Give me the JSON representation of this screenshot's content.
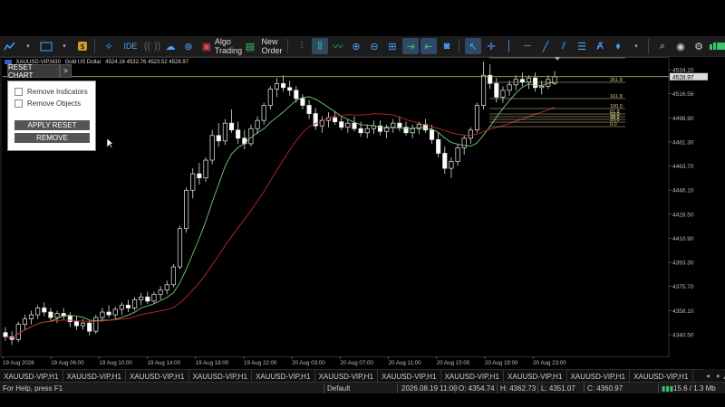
{
  "toolbar": {
    "algo_trading_label": "Algo Trading",
    "new_order_label": "New Order",
    "ide_label": "IDE"
  },
  "chart_info": {
    "symbol": "XAUUSD-VIP,M30",
    "description": "Gold US Dollar",
    "ohlc": "4524.16 4532.76 4523.52 4528.97"
  },
  "reset_chart": {
    "button_label": "RESET CHART",
    "arrow_label": ">",
    "remove_indicators_label": "Remove Indicators",
    "remove_objects_label": "Remove Objects",
    "apply_reset_label": "APPLY RESET",
    "remove_label": "REMOVE"
  },
  "chart_data": {
    "type": "candlestick",
    "current_price": "4528.97",
    "price_ticks": [
      "4534.10",
      "4516.56",
      "4498.90",
      "4481.30",
      "4463.70",
      "4446.10",
      "4428.50",
      "4410.90",
      "4393.30",
      "4375.70",
      "4358.10",
      "4340.50"
    ],
    "time_ticks": [
      "19 Aug 2026",
      "19 Aug 06:00",
      "19 Aug 10:00",
      "19 Aug 14:00",
      "19 Aug 18:00",
      "19 Aug 22:00",
      "20 Aug 03:00",
      "20 Aug 07:00",
      "20 Aug 11:00",
      "20 Aug 15:00",
      "20 Aug 19:00",
      "20 Aug 23:00"
    ],
    "fib_levels": [
      "423.6",
      "261.8",
      "161.8",
      "100.0",
      "61.8",
      "50.0",
      "38.2",
      "23.6",
      "0.0"
    ],
    "candles": [
      [
        4342,
        4346,
        4336,
        4339
      ],
      [
        4339,
        4343,
        4333,
        4337
      ],
      [
        4337,
        4350,
        4335,
        4348
      ],
      [
        4348,
        4355,
        4344,
        4352
      ],
      [
        4352,
        4358,
        4348,
        4355
      ],
      [
        4355,
        4362,
        4352,
        4360
      ],
      [
        4360,
        4364,
        4354,
        4357
      ],
      [
        4357,
        4360,
        4350,
        4353
      ],
      [
        4353,
        4358,
        4349,
        4356
      ],
      [
        4356,
        4360,
        4351,
        4354
      ],
      [
        4354,
        4357,
        4346,
        4350
      ],
      [
        4350,
        4354,
        4344,
        4347
      ],
      [
        4347,
        4352,
        4344,
        4349
      ],
      [
        4349,
        4351,
        4340,
        4343
      ],
      [
        4343,
        4355,
        4341,
        4353
      ],
      [
        4353,
        4360,
        4350,
        4357
      ],
      [
        4357,
        4362,
        4353,
        4355
      ],
      [
        4355,
        4361,
        4352,
        4359
      ],
      [
        4359,
        4364,
        4355,
        4362
      ],
      [
        4362,
        4366,
        4357,
        4360
      ],
      [
        4360,
        4368,
        4358,
        4366
      ],
      [
        4366,
        4371,
        4362,
        4368
      ],
      [
        4368,
        4372,
        4363,
        4365
      ],
      [
        4365,
        4372,
        4363,
        4370
      ],
      [
        4370,
        4376,
        4366,
        4373
      ],
      [
        4373,
        4380,
        4370,
        4377
      ],
      [
        4377,
        4392,
        4375,
        4390
      ],
      [
        4390,
        4420,
        4388,
        4418
      ],
      [
        4418,
        4448,
        4415,
        4446
      ],
      [
        4446,
        4462,
        4440,
        4458
      ],
      [
        4458,
        4466,
        4450,
        4455
      ],
      [
        4455,
        4470,
        4452,
        4468
      ],
      [
        4468,
        4490,
        4465,
        4486
      ],
      [
        4486,
        4495,
        4478,
        4482
      ],
      [
        4482,
        4498,
        4479,
        4495
      ],
      [
        4495,
        4505,
        4488,
        4490
      ],
      [
        4490,
        4496,
        4480,
        4484
      ],
      [
        4484,
        4490,
        4476,
        4480
      ],
      [
        4480,
        4494,
        4478,
        4491
      ],
      [
        4491,
        4500,
        4487,
        4497
      ],
      [
        4497,
        4510,
        4494,
        4508
      ],
      [
        4508,
        4522,
        4505,
        4520
      ],
      [
        4520,
        4528,
        4514,
        4524
      ],
      [
        4524,
        4530,
        4518,
        4521
      ],
      [
        4521,
        4526,
        4515,
        4519
      ],
      [
        4519,
        4522,
        4510,
        4513
      ],
      [
        4513,
        4516,
        4505,
        4508
      ],
      [
        4508,
        4512,
        4498,
        4502
      ],
      [
        4502,
        4506,
        4490,
        4493
      ],
      [
        4493,
        4500,
        4488,
        4497
      ],
      [
        4497,
        4503,
        4492,
        4499
      ],
      [
        4499,
        4504,
        4494,
        4496
      ],
      [
        4496,
        4500,
        4490,
        4492
      ],
      [
        4492,
        4498,
        4488,
        4495
      ],
      [
        4495,
        4500,
        4489,
        4491
      ],
      [
        4491,
        4496,
        4485,
        4488
      ],
      [
        4488,
        4494,
        4484,
        4491
      ],
      [
        4491,
        4497,
        4487,
        4493
      ],
      [
        4493,
        4497,
        4486,
        4489
      ],
      [
        4489,
        4494,
        4484,
        4492
      ],
      [
        4492,
        4498,
        4488,
        4495
      ],
      [
        4495,
        4500,
        4489,
        4492
      ],
      [
        4492,
        4496,
        4486,
        4488
      ],
      [
        4488,
        4494,
        4484,
        4491
      ],
      [
        4491,
        4496,
        4487,
        4494
      ],
      [
        4494,
        4498,
        4488,
        4490
      ],
      [
        4490,
        4494,
        4480,
        4483
      ],
      [
        4483,
        4488,
        4470,
        4473
      ],
      [
        4473,
        4478,
        4458,
        4462
      ],
      [
        4462,
        4470,
        4455,
        4467
      ],
      [
        4467,
        4480,
        4464,
        4477
      ],
      [
        4477,
        4486,
        4472,
        4484
      ],
      [
        4484,
        4492,
        4480,
        4490
      ],
      [
        4490,
        4510,
        4488,
        4508
      ],
      [
        4508,
        4540,
        4505,
        4530
      ],
      [
        4530,
        4538,
        4520,
        4524
      ],
      [
        4524,
        4528,
        4510,
        4514
      ],
      [
        4514,
        4522,
        4510,
        4519
      ],
      [
        4519,
        4526,
        4515,
        4523
      ],
      [
        4523,
        4530,
        4519,
        4527
      ],
      [
        4527,
        4532,
        4522,
        4525
      ],
      [
        4525,
        4530,
        4520,
        4528
      ],
      [
        4528,
        4532,
        4518,
        4521
      ],
      [
        4521,
        4526,
        4516,
        4522
      ],
      [
        4522,
        4530,
        4520,
        4527
      ],
      [
        4524,
        4533,
        4523,
        4529
      ]
    ]
  },
  "symbol_tabs": [
    "XAUUSD-VIP,H1",
    "XAUUSD-VIP,H1",
    "XAUUSD-VIP,H1",
    "XAUUSD-VIP,H1",
    "XAUUSD-VIP,H1",
    "XAUUSD-VIP,H1",
    "XAUUSD-VIP,H1",
    "XAUUSD-VIP,H1",
    "XAUUSD-VIP,H1",
    "XAUUSD-VIP,H1",
    "XAUUSD-VIP,H1",
    "XA"
  ],
  "status": {
    "help": "For Help, press F1",
    "profile": "Default",
    "datetime": "2026.08.19 11:00",
    "open": "O: 4354.74",
    "high": "H: 4362.73",
    "low": "L: 4351.07",
    "close": "C: 4360.97",
    "traffic": "15.6 / 1.3 Mb"
  },
  "colors": {
    "bull": "#ffffff",
    "bear": "#ffffff",
    "ma_fast": "#6fcf6f",
    "ma_slow": "#c0282c",
    "price_line": "#cfc08a",
    "fib": "#d8c890",
    "accent": "#4aa3ff"
  }
}
